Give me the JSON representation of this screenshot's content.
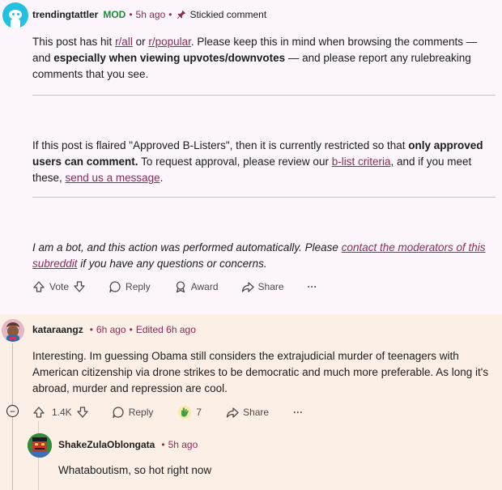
{
  "colors": {
    "accent": "#8a2b58",
    "mod": "#1e8a36",
    "page_bg": "#fcf5fb",
    "highlight_bg": "#fcefe5"
  },
  "mod_comment": {
    "username": "trendingtattler",
    "mod_badge": "MOD",
    "separator": "•",
    "time": "5h ago",
    "sticky_label": "Stickied comment",
    "para1": {
      "t1": "This post has hit ",
      "link1": "r/all",
      "t2": " or ",
      "link2": "r/popular",
      "t3": ". Please keep this in mind when browsing the comments — and ",
      "bold": "especially when viewing upvotes/downvotes",
      "t4": " — and please report any rulebreaking comments that you see."
    },
    "para2": {
      "t1": "If this post is flaired \"Approved B-Listers\", then it is currently restricted so that ",
      "bold": "only approved users can comment.",
      "t2": " To request approval, please review our ",
      "link1": "b-list criteria",
      "t3": ", and if you meet these, ",
      "link2": "send us a message",
      "t4": "."
    },
    "para3": {
      "t1": "I am a bot, and this action was performed automatically. Please ",
      "link1": "contact the moderators of this subreddit",
      "t2": " if you have any questions or concerns."
    },
    "actions": {
      "vote": "Vote",
      "reply": "Reply",
      "award": "Award",
      "share": "Share",
      "more": "···"
    }
  },
  "comment2": {
    "username": "kataraangz",
    "separator": "•",
    "time": "6h ago",
    "edited": "Edited 6h ago",
    "text": "Interesting. Im guessing Obama still considers the extrajudicial murder of teenagers with American citizenship via drone strikes to be democratic and much more preferable. As long it's abroad, murder and repression are cool.",
    "collapse": "−",
    "actions": {
      "score": "1.4K",
      "reply": "Reply",
      "award_count": "7",
      "share": "Share",
      "more": "···"
    }
  },
  "comment3": {
    "username": "ShakeZulaOblongata",
    "separator": "•",
    "time": "5h ago",
    "text": "Whataboutism, so hot right now"
  }
}
